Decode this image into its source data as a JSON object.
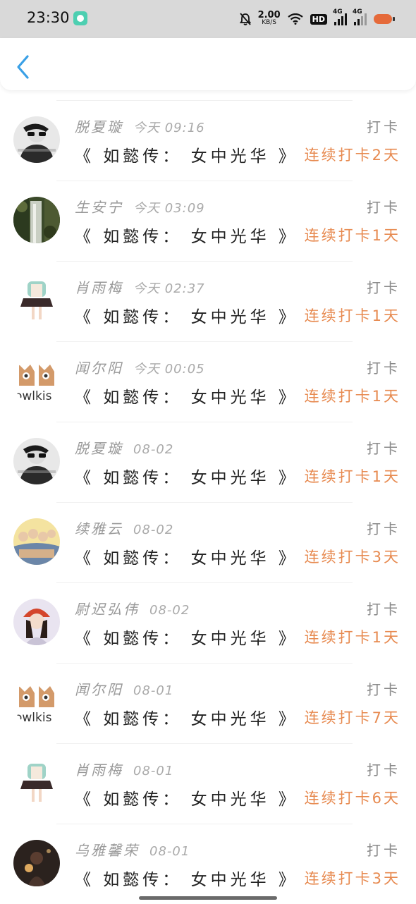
{
  "status_bar": {
    "time": "23:30",
    "speed_value": "2.00",
    "speed_unit": "KB/S",
    "hd_label": "HD",
    "net1": "4G",
    "net2": "4G",
    "battery": "76"
  },
  "header": {
    "back_icon": "chevron-left-icon"
  },
  "entries": [
    {
      "name": "脱夏璇",
      "date": "今天 09:16",
      "label": "打卡",
      "title": "《 如懿传： 女中光华 》",
      "streak": "连续打卡2天",
      "avatar": "bw-portrait"
    },
    {
      "name": "生安宁",
      "date": "今天 03:09",
      "label": "打卡",
      "title": "《 如懿传： 女中光华 》",
      "streak": "连续打卡1天",
      "avatar": "waterfall"
    },
    {
      "name": "肖雨梅",
      "date": "今天 02:37",
      "label": "打卡",
      "title": "《 如懿传： 女中光华 》",
      "streak": "连续打卡1天",
      "avatar": "girl-illustration"
    },
    {
      "name": "闻尔阳",
      "date": "今天 00:05",
      "label": "打卡",
      "title": "《 如懿传： 女中光华 》",
      "streak": "连续打卡1天",
      "avatar": "owl-logo"
    },
    {
      "name": "脱夏璇",
      "date": "08-02",
      "label": "打卡",
      "title": "《 如懿传： 女中光华 》",
      "streak": "连续打卡1天",
      "avatar": "bw-portrait"
    },
    {
      "name": "续雅云",
      "date": "08-02",
      "label": "打卡",
      "title": "《 如懿传： 女中光华 》",
      "streak": "连续打卡3天",
      "avatar": "group-photo"
    },
    {
      "name": "尉迟弘伟",
      "date": "08-02",
      "label": "打卡",
      "title": "《 如懿传： 女中光华 》",
      "streak": "连续打卡1天",
      "avatar": "girl-red-hat"
    },
    {
      "name": "闻尔阳",
      "date": "08-01",
      "label": "打卡",
      "title": "《 如懿传： 女中光华 》",
      "streak": "连续打卡7天",
      "avatar": "owl-logo"
    },
    {
      "name": "肖雨梅",
      "date": "08-01",
      "label": "打卡",
      "title": "《 如懿传： 女中光华 》",
      "streak": "连续打卡6天",
      "avatar": "girl-illustration"
    },
    {
      "name": "乌雅馨荣",
      "date": "08-01",
      "label": "打卡",
      "title": "《 如懿传： 女中光华 》",
      "streak": "连续打卡3天",
      "avatar": "night-portrait"
    }
  ],
  "owl_logo_text": "owlkis",
  "colors": {
    "accent_blue": "#3aa0e6",
    "streak_orange": "#e78a50"
  }
}
